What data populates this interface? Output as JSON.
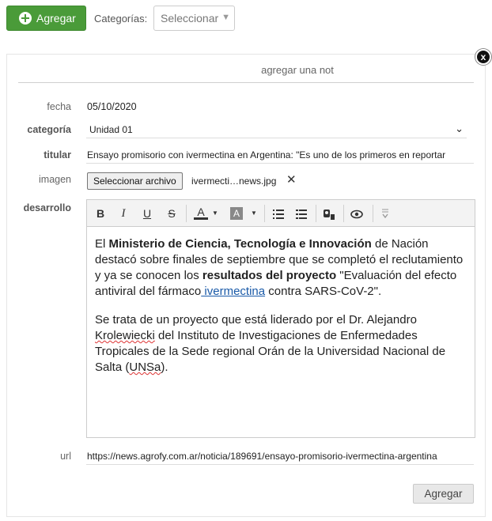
{
  "topbar": {
    "add_label": "Agregar",
    "categories_label": "Categorías:",
    "categories_selected": "Seleccionar"
  },
  "panel": {
    "close_label": "x",
    "title": "agregar una not",
    "fields": {
      "fecha": {
        "label": "fecha",
        "value": "05/10/2020"
      },
      "categoria": {
        "label": "categoría",
        "value": "Unidad 01"
      },
      "titular": {
        "label": "titular",
        "value": "Ensayo promisorio con ivermectina en Argentina: \"Es uno de los primeros en reportar"
      },
      "imagen": {
        "label": "imagen",
        "button": "Seleccionar archivo",
        "file_name": "ivermecti…news.jpg",
        "remove": "✕"
      },
      "desarrollo": {
        "label": "desarrollo"
      },
      "url": {
        "label": "url",
        "value": "https://news.agrofy.com.ar/noticia/189691/ensayo-promisorio-ivermectina-argentina"
      }
    },
    "toolbar": {
      "bold": "B",
      "italic": "I",
      "underline": "U",
      "strike": "S",
      "font_color": "A",
      "bg_color": "A"
    },
    "content": {
      "p1": {
        "t1": "El ",
        "b1": "Ministerio de Ciencia, Tecnología e Innovación",
        "t2": " de Nación destacó sobre finales de septiembre que se completó el reclutamiento y ya se conocen los ",
        "b2": "resultados del proyecto",
        "t3": " \"Evaluación del efecto antiviral del fármaco",
        "link": " ivermectina",
        "t4": " contra SARS-CoV-2\"."
      },
      "p2": {
        "t1": "Se trata de un proyecto que está liderado por el Dr. Alejandro ",
        "w1": "Krolewiecki",
        "t2": " del Instituto de Investigaciones de Enfermedades Tropicales de la Sede regional Orán de la Universidad Nacional de Salta (",
        "w2": "UNSa",
        "t3": ")."
      }
    },
    "submit_label": "Agregar"
  }
}
